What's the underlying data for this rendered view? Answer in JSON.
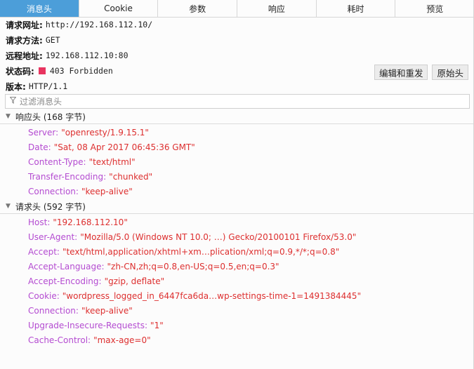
{
  "tabs": [
    {
      "label": "消息头",
      "active": true
    },
    {
      "label": "Cookie",
      "active": false
    },
    {
      "label": "参数",
      "active": false
    },
    {
      "label": "响应",
      "active": false
    },
    {
      "label": "耗时",
      "active": false
    },
    {
      "label": "预览",
      "active": false
    }
  ],
  "summary": {
    "url_label": "请求网址:",
    "url_value": "http://192.168.112.10/",
    "method_label": "请求方法:",
    "method_value": "GET",
    "remote_label": "远程地址:",
    "remote_value": "192.168.112.10:80",
    "status_label": "状态码:",
    "status_value": "403 Forbidden",
    "status_color": "#e8345f",
    "version_label": "版本:",
    "version_value": "HTTP/1.1"
  },
  "buttons": {
    "edit_resend": "编辑和重发",
    "raw_headers": "原始头"
  },
  "filter": {
    "placeholder": "过滤消息头",
    "icon": "filter-icon"
  },
  "response_headers": {
    "title": "响应头 (168 字节)",
    "items": [
      {
        "name": "Server:",
        "value": "\"openresty/1.9.15.1\""
      },
      {
        "name": "Date:",
        "value": "\"Sat, 08 Apr 2017 06:45:36 GMT\""
      },
      {
        "name": "Content-Type:",
        "value": "\"text/html\""
      },
      {
        "name": "Transfer-Encoding:",
        "value": "\"chunked\""
      },
      {
        "name": "Connection:",
        "value": "\"keep-alive\""
      }
    ]
  },
  "request_headers": {
    "title": "请求头 (592 字节)",
    "items": [
      {
        "name": "Host:",
        "value": "\"192.168.112.10\""
      },
      {
        "name": "User-Agent:",
        "value": "\"Mozilla/5.0 (Windows NT 10.0; …) Gecko/20100101 Firefox/53.0\""
      },
      {
        "name": "Accept:",
        "value": "\"text/html,application/xhtml+xm…plication/xml;q=0.9,*/*;q=0.8\""
      },
      {
        "name": "Accept-Language:",
        "value": "\"zh-CN,zh;q=0.8,en-US;q=0.5,en;q=0.3\""
      },
      {
        "name": "Accept-Encoding:",
        "value": "\"gzip, deflate\""
      },
      {
        "name": "Cookie:",
        "value": "\"wordpress_logged_in_6447fca6da…wp-settings-time-1=1491384445\""
      },
      {
        "name": "Connection:",
        "value": "\"keep-alive\""
      },
      {
        "name": "Upgrade-Insecure-Requests:",
        "value": "\"1\""
      },
      {
        "name": "Cache-Control:",
        "value": "\"max-age=0\""
      }
    ]
  },
  "colors": {
    "tab_active": "#4c9ed9",
    "header_name": "#b44bd1",
    "header_value": "#dd2f2f"
  }
}
